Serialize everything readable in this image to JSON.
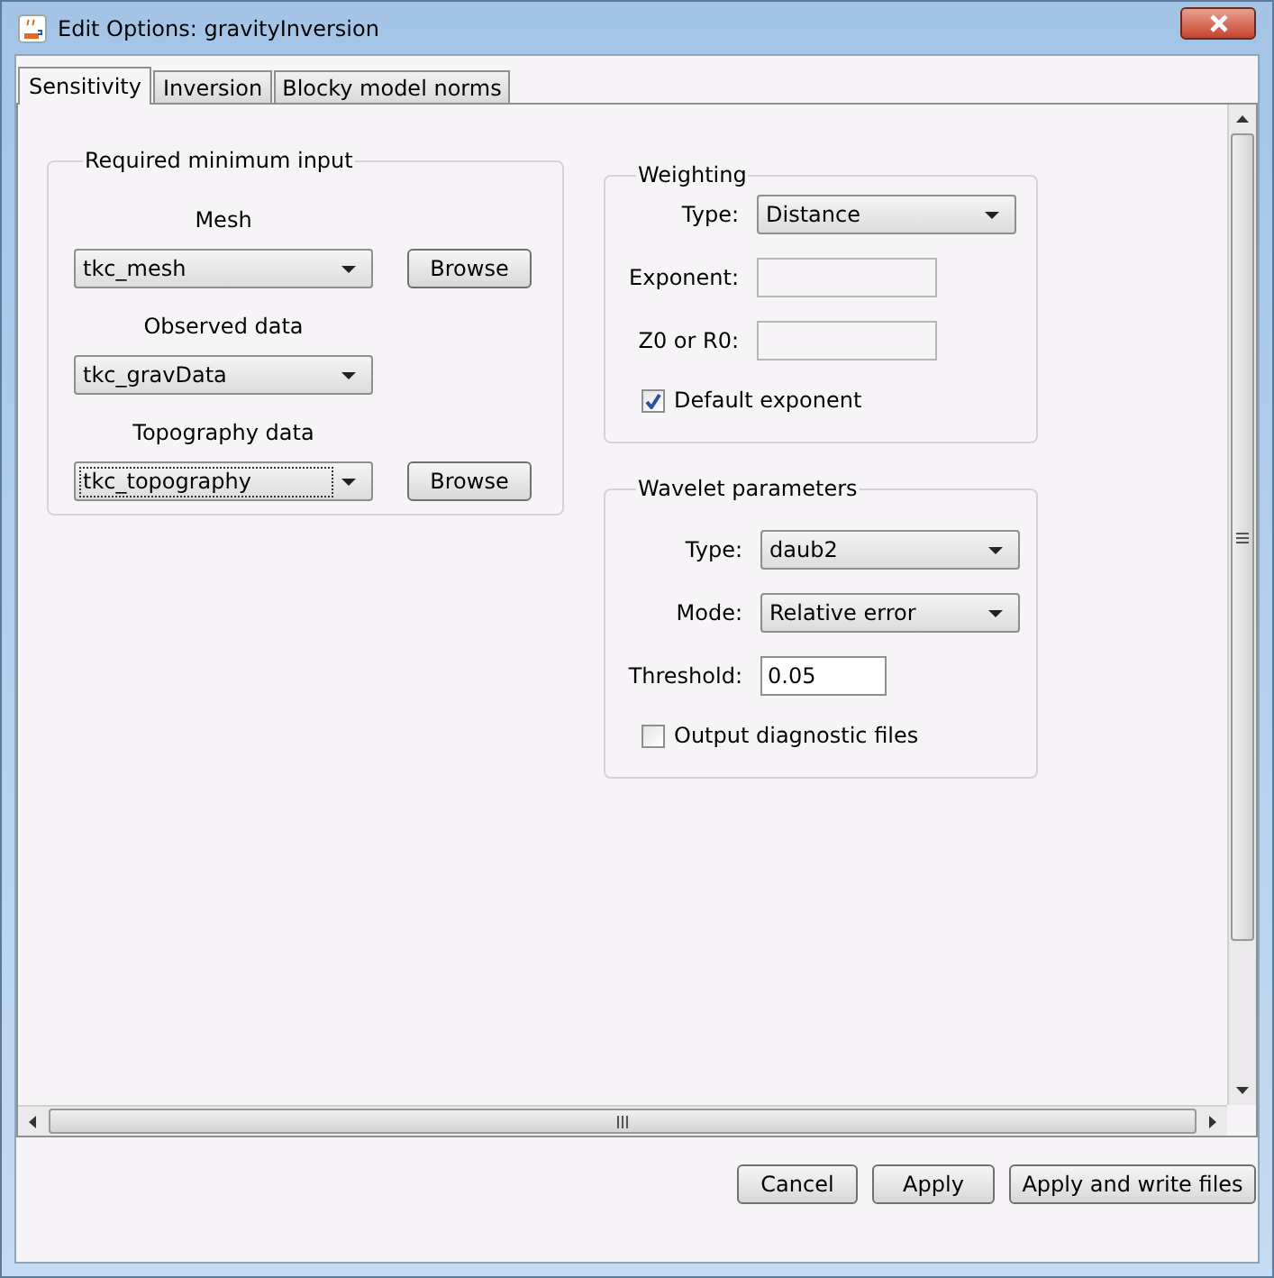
{
  "window": {
    "title": "Edit Options: gravityInversion"
  },
  "tabs": [
    {
      "label": "Sensitivity",
      "selected": true
    },
    {
      "label": "Inversion",
      "selected": false
    },
    {
      "label": "Blocky model norms",
      "selected": false
    }
  ],
  "required_input": {
    "title": "Required minimum input",
    "rows": [
      {
        "label": "Mesh",
        "value": "tkc_mesh",
        "focused": false,
        "browse_button": "Browse"
      },
      {
        "label": "Observed data",
        "value": "tkc_gravData",
        "focused": false
      },
      {
        "label": "Topography data",
        "value": "tkc_topography",
        "focused": true,
        "browse_button": "Browse"
      }
    ]
  },
  "groups": [
    {
      "title": "Weighting",
      "fields": [
        {
          "kind": "combo",
          "label": "Type:",
          "value": "Distance"
        },
        {
          "kind": "text",
          "label": "Exponent:"
        },
        {
          "kind": "text",
          "label": "Z0 or R0:"
        },
        {
          "kind": "checkbox",
          "label": "Default exponent",
          "checked": true
        }
      ]
    },
    {
      "title": "Wavelet parameters",
      "fields": [
        {
          "kind": "combo",
          "label": "Type:",
          "value": "daub2"
        },
        {
          "kind": "combo",
          "label": "Mode:",
          "value": "Relative error"
        },
        {
          "kind": "text",
          "label": "Threshold:",
          "value": "0.05"
        },
        {
          "kind": "checkbox",
          "label": "Output diagnostic files",
          "checked": false
        }
      ]
    }
  ],
  "buttons": [
    "Cancel",
    "Apply",
    "Apply and write files"
  ]
}
